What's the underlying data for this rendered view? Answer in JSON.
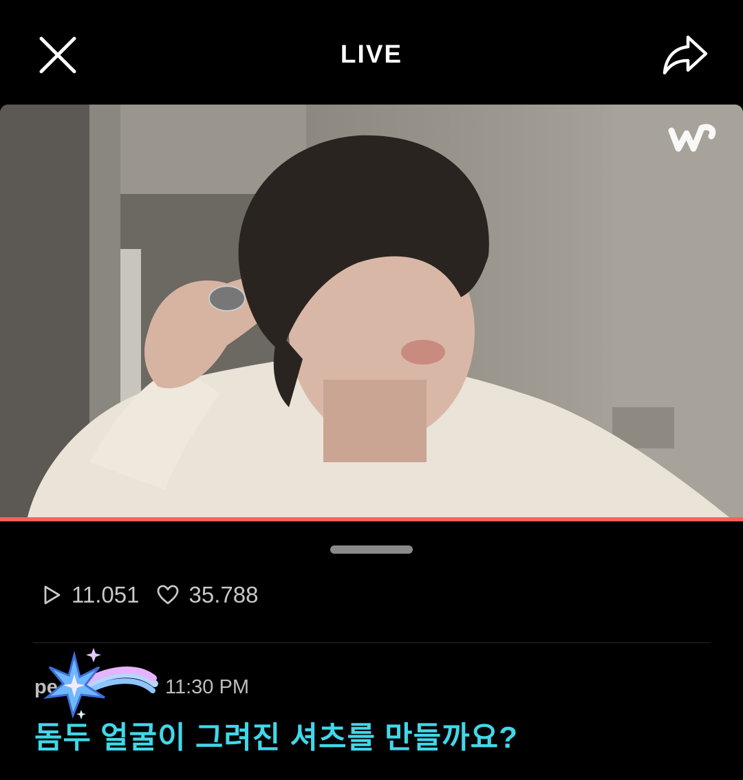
{
  "header": {
    "title": "LIVE"
  },
  "video": {
    "progress": 1.0,
    "accent_color": "#ff5f5b"
  },
  "stats": {
    "plays": "11.051",
    "likes": "35.788"
  },
  "comment": {
    "username": "pe",
    "time": "11:30 PM",
    "text": "돔두 얼굴이 그려진 셔츠를 만들까요?",
    "text_color": "#40d8ea"
  }
}
